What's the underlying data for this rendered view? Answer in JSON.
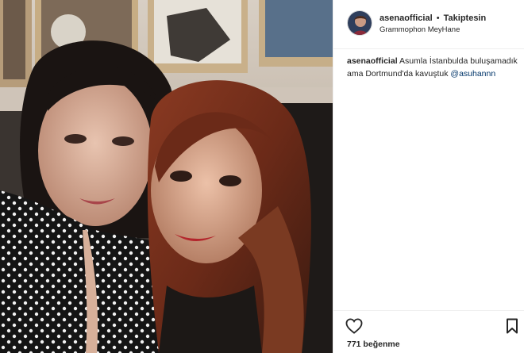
{
  "post": {
    "username": "asenaofficial",
    "separator": "•",
    "follow_status": "Takiptesin",
    "location": "Grammophon MeyHane",
    "caption_username": "asenaofficial",
    "caption_text": "Asumla İstanbulda buluşamadık ama Dortmund'da kavuştuk",
    "mention": "@asuhannn",
    "likes": "771 beğenme"
  },
  "icons": {
    "like": "heart-icon",
    "save": "bookmark-icon"
  },
  "colors": {
    "text": "#262626",
    "mention": "#003569",
    "divider": "#efefef"
  }
}
